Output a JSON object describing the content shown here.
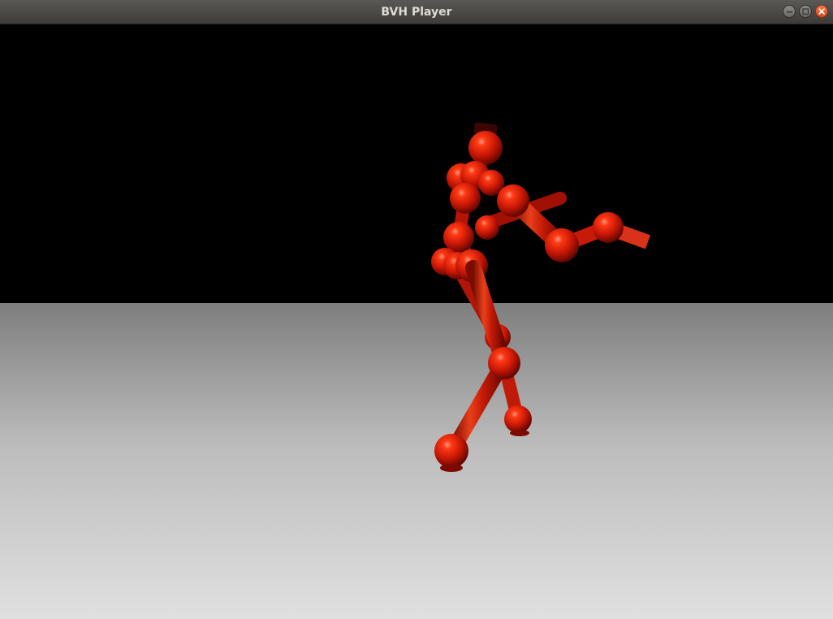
{
  "window": {
    "title": "BVH Player",
    "controls": {
      "minimize_icon": "minimize-icon",
      "maximize_icon": "maximize-icon",
      "close_icon": "close-icon"
    }
  },
  "scene": {
    "sky_color": "#000000",
    "floor_color_far": "#7e7e7e",
    "floor_color_near": "#dedede",
    "skeleton_color": "#e01a08"
  }
}
